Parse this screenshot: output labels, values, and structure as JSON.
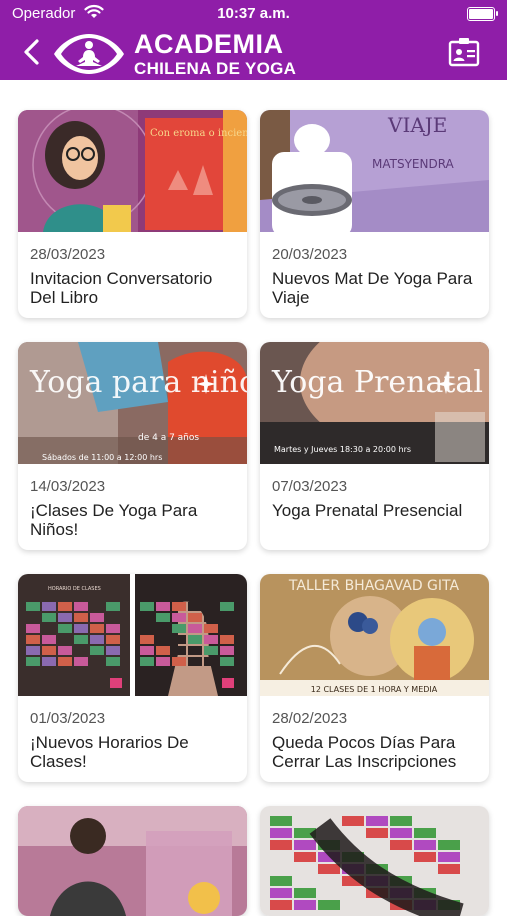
{
  "status_bar": {
    "carrier": "Operador",
    "time": "10:37 a.m."
  },
  "header": {
    "brand_line1": "ACADEMIA",
    "brand_line2": "CHILENA DE YOGA",
    "accent_color": "#8f1ea8"
  },
  "cards": [
    {
      "date": "28/03/2023",
      "title": "Invitacion Conversatorio Del Libro",
      "thumb_text": "Con eroma o incienso"
    },
    {
      "date": "20/03/2023",
      "title": "Nuevos Mat De Yoga Para Viaje",
      "thumb_text": "VIAJE",
      "thumb_sub": "MATSYENDRA"
    },
    {
      "date": "14/03/2023",
      "title": "¡Clases De Yoga Para Niños!",
      "thumb_text": "Yoga para niños",
      "thumb_sub": "de 4 a 7 años",
      "thumb_note": "Sábados de 11:00 a 12:00 hrs"
    },
    {
      "date": "07/03/2023",
      "title": "Yoga Prenatal Presencial",
      "thumb_text": "Yoga Prenatal",
      "thumb_note": "Martes y Jueves 18:30 a 20:00 hrs"
    },
    {
      "date": "01/03/2023",
      "title": "¡Nuevos Horarios De Clases!",
      "thumb_text": "HORARIO DE CLASES"
    },
    {
      "date": "28/02/2023",
      "title": "Queda Pocos Días Para Cerrar Las Inscripciones",
      "thumb_text": "TALLER BHAGAVAD GITA",
      "thumb_note": "12 CLASES DE 1 HORA Y MEDIA"
    },
    {
      "date": "",
      "title": ""
    },
    {
      "date": "",
      "title": ""
    }
  ]
}
